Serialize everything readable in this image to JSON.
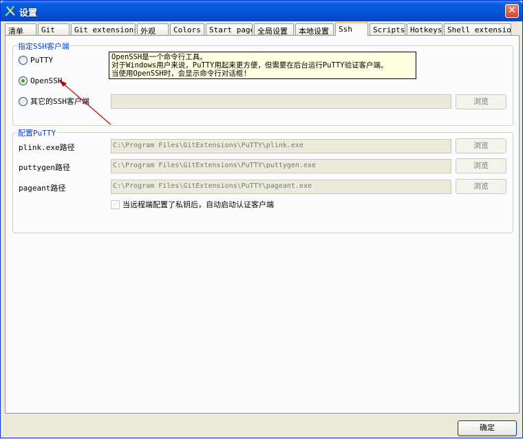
{
  "window": {
    "title": "设置"
  },
  "tabs": [
    {
      "label": "清单"
    },
    {
      "label": "Git"
    },
    {
      "label": "Git extensions"
    },
    {
      "label": "外观"
    },
    {
      "label": "Colors"
    },
    {
      "label": "Start page"
    },
    {
      "label": "全局设置"
    },
    {
      "label": "本地设置"
    },
    {
      "label": "Ssh",
      "active": true
    },
    {
      "label": "Scripts"
    },
    {
      "label": "Hotkeys"
    },
    {
      "label": "Shell extension"
    }
  ],
  "ssh_group": {
    "title": "指定SSH客户端",
    "options": [
      {
        "label": "PuTTY",
        "checked": false
      },
      {
        "label": "OpenSSH",
        "checked": true
      },
      {
        "label": "其它的SSH客户端",
        "checked": false
      }
    ],
    "other_path": "",
    "browse_label": "浏览"
  },
  "tooltip": {
    "lines": [
      "OpenSSH是一个命令行工具。",
      "对于Windows用户来说，PuTTY用起来更方便，但需要在后台运行PuTTY验证客户端。",
      "当使用OpenSSH时，会显示命令行对话框!"
    ]
  },
  "putty_group": {
    "title": "配置PuTTY",
    "rows": [
      {
        "label": "plink.exe路径",
        "value": "C:\\Program Files\\GitExtensions\\PuTTY\\plink.exe",
        "browse": "浏览"
      },
      {
        "label": "puttygen路径",
        "value": "C:\\Program Files\\GitExtensions\\PuTTY\\puttygen.exe",
        "browse": "浏览"
      },
      {
        "label": "pageant路径",
        "value": "C:\\Program Files\\GitExtensions\\PuTTY\\pageant.exe",
        "browse": "浏览"
      }
    ],
    "autostart_label": "当远程端配置了私钥后，自动启动认证客户端",
    "autostart_checked": true
  },
  "footer": {
    "ok_label": "确定"
  },
  "colors": {
    "title_bar": "#0352d6",
    "group_title": "#0046d5",
    "tab_highlight": "#ffc83c",
    "annotation_arrow": "#c00000"
  }
}
